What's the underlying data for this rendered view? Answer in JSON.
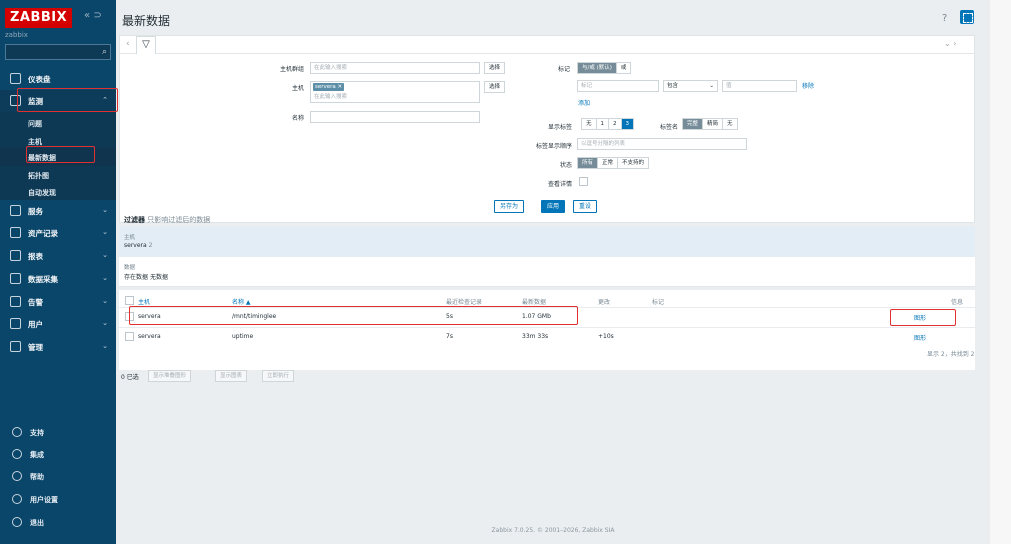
{
  "brand": {
    "logo": "ZABBIX",
    "instance": "zabbix",
    "collapse": "«",
    "kiosk": "⊃"
  },
  "sidebar": {
    "search_placeholder": "",
    "menu": [
      {
        "label": "仪表盘"
      },
      {
        "label": "监测"
      },
      {
        "label": "服务"
      },
      {
        "label": "资产记录"
      },
      {
        "label": "报表"
      },
      {
        "label": "数据采集"
      },
      {
        "label": "告警"
      },
      {
        "label": "用户"
      },
      {
        "label": "管理"
      }
    ],
    "submenu": [
      "问题",
      "主机",
      "最新数据",
      "拓扑图",
      "自动发现"
    ],
    "bottom": [
      "支持",
      "集成",
      "帮助",
      "用户设置",
      "退出"
    ]
  },
  "header": {
    "title": "最新数据",
    "help": "?"
  },
  "filter": {
    "host_groups_label": "主机群组",
    "host_groups_placeholder": "在此输入搜索",
    "select_label": "选择",
    "hosts_label": "主机",
    "host_chip": "servera ✕",
    "hosts_placeholder": "在此输入搜索",
    "name_label": "名称",
    "tags_label": "标记",
    "tags_mode": [
      "与/或 (默认)",
      "或"
    ],
    "tag_placeholder": "标记",
    "tag_operator": "包含",
    "value_placeholder": "值",
    "remove_link": "移除",
    "add_link": "添加",
    "show_tags_label": "显示标签",
    "show_tags_options": [
      "无",
      "1",
      "2",
      "3"
    ],
    "tag_name_label": "标签名",
    "tag_name_options": [
      "完整",
      "精简",
      "无"
    ],
    "tag_priority_label": "标签显示顺序",
    "tag_priority_placeholder": "以逗号分隔的列表",
    "state_label": "状态",
    "state_options": [
      "所有",
      "正常",
      "不支持的"
    ],
    "show_details_label": "查看详情",
    "save_as": "另存为",
    "apply": "应用",
    "reset": "重设"
  },
  "filter_summary": {
    "title": "过滤器",
    "subtitle": "只影响过滤后的数据",
    "hosts_key": "主机",
    "hosts_value": "servera",
    "hosts_count": "2",
    "data_key": "数据",
    "data_with": "存在数据",
    "data_without": "无数据"
  },
  "table": {
    "headers": [
      "主机",
      "名称 ▲",
      "最近检查记录",
      "最新数据",
      "更改",
      "标记",
      "信息"
    ],
    "rows": [
      {
        "host": "servera",
        "name": "/mnt/timinglee",
        "last_check": "5s",
        "last_value": "1.07 GMb",
        "change": "",
        "action": "图形"
      },
      {
        "host": "servera",
        "name": "uptime",
        "last_check": "7s",
        "last_value": "33m 33s",
        "change": "+10s",
        "action": "图形"
      }
    ],
    "summary": "显示 2，共找到 2"
  },
  "bulk": {
    "count": "0 已选",
    "buttons": [
      "显示堆叠图形",
      "显示图表",
      "立即执行"
    ]
  },
  "footer": "Zabbix 7.0.25. © 2001–2026, Zabbix SIA"
}
